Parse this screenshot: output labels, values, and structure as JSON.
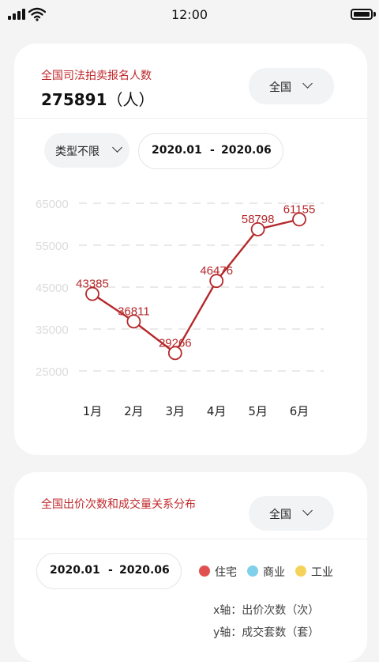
{
  "status_bar": {
    "time": "12:00"
  },
  "card1": {
    "title": "全国司法拍卖报名人数",
    "total_value": "275891",
    "total_unit": "（人）",
    "region_select": "全国",
    "type_select": "类型不限",
    "date_start": "2020.01",
    "date_sep": "-",
    "date_end": "2020.06"
  },
  "chart_data": {
    "type": "line",
    "categories": [
      "1月",
      "2月",
      "3月",
      "4月",
      "5月",
      "6月"
    ],
    "values": [
      43385,
      36811,
      29266,
      46476,
      58798,
      61155
    ],
    "y_ticks": [
      "65000",
      "55000",
      "45000",
      "35000",
      "25000"
    ],
    "ylim": [
      25000,
      65000
    ],
    "grid": true,
    "line_color": "#b5282b"
  },
  "card2": {
    "title": "全国出价次数和成交量关系分布",
    "region_select": "全国",
    "date_start": "2020.01",
    "date_sep": "-",
    "date_end": "2020.06",
    "legend": [
      {
        "label": "住宅",
        "color": "#e05050"
      },
      {
        "label": "商业",
        "color": "#7fd0ea"
      },
      {
        "label": "工业",
        "color": "#f5d35a"
      }
    ],
    "x_axis_note": "x轴：出价次数（次）",
    "y_axis_note": "y轴：成交套数（套）"
  }
}
